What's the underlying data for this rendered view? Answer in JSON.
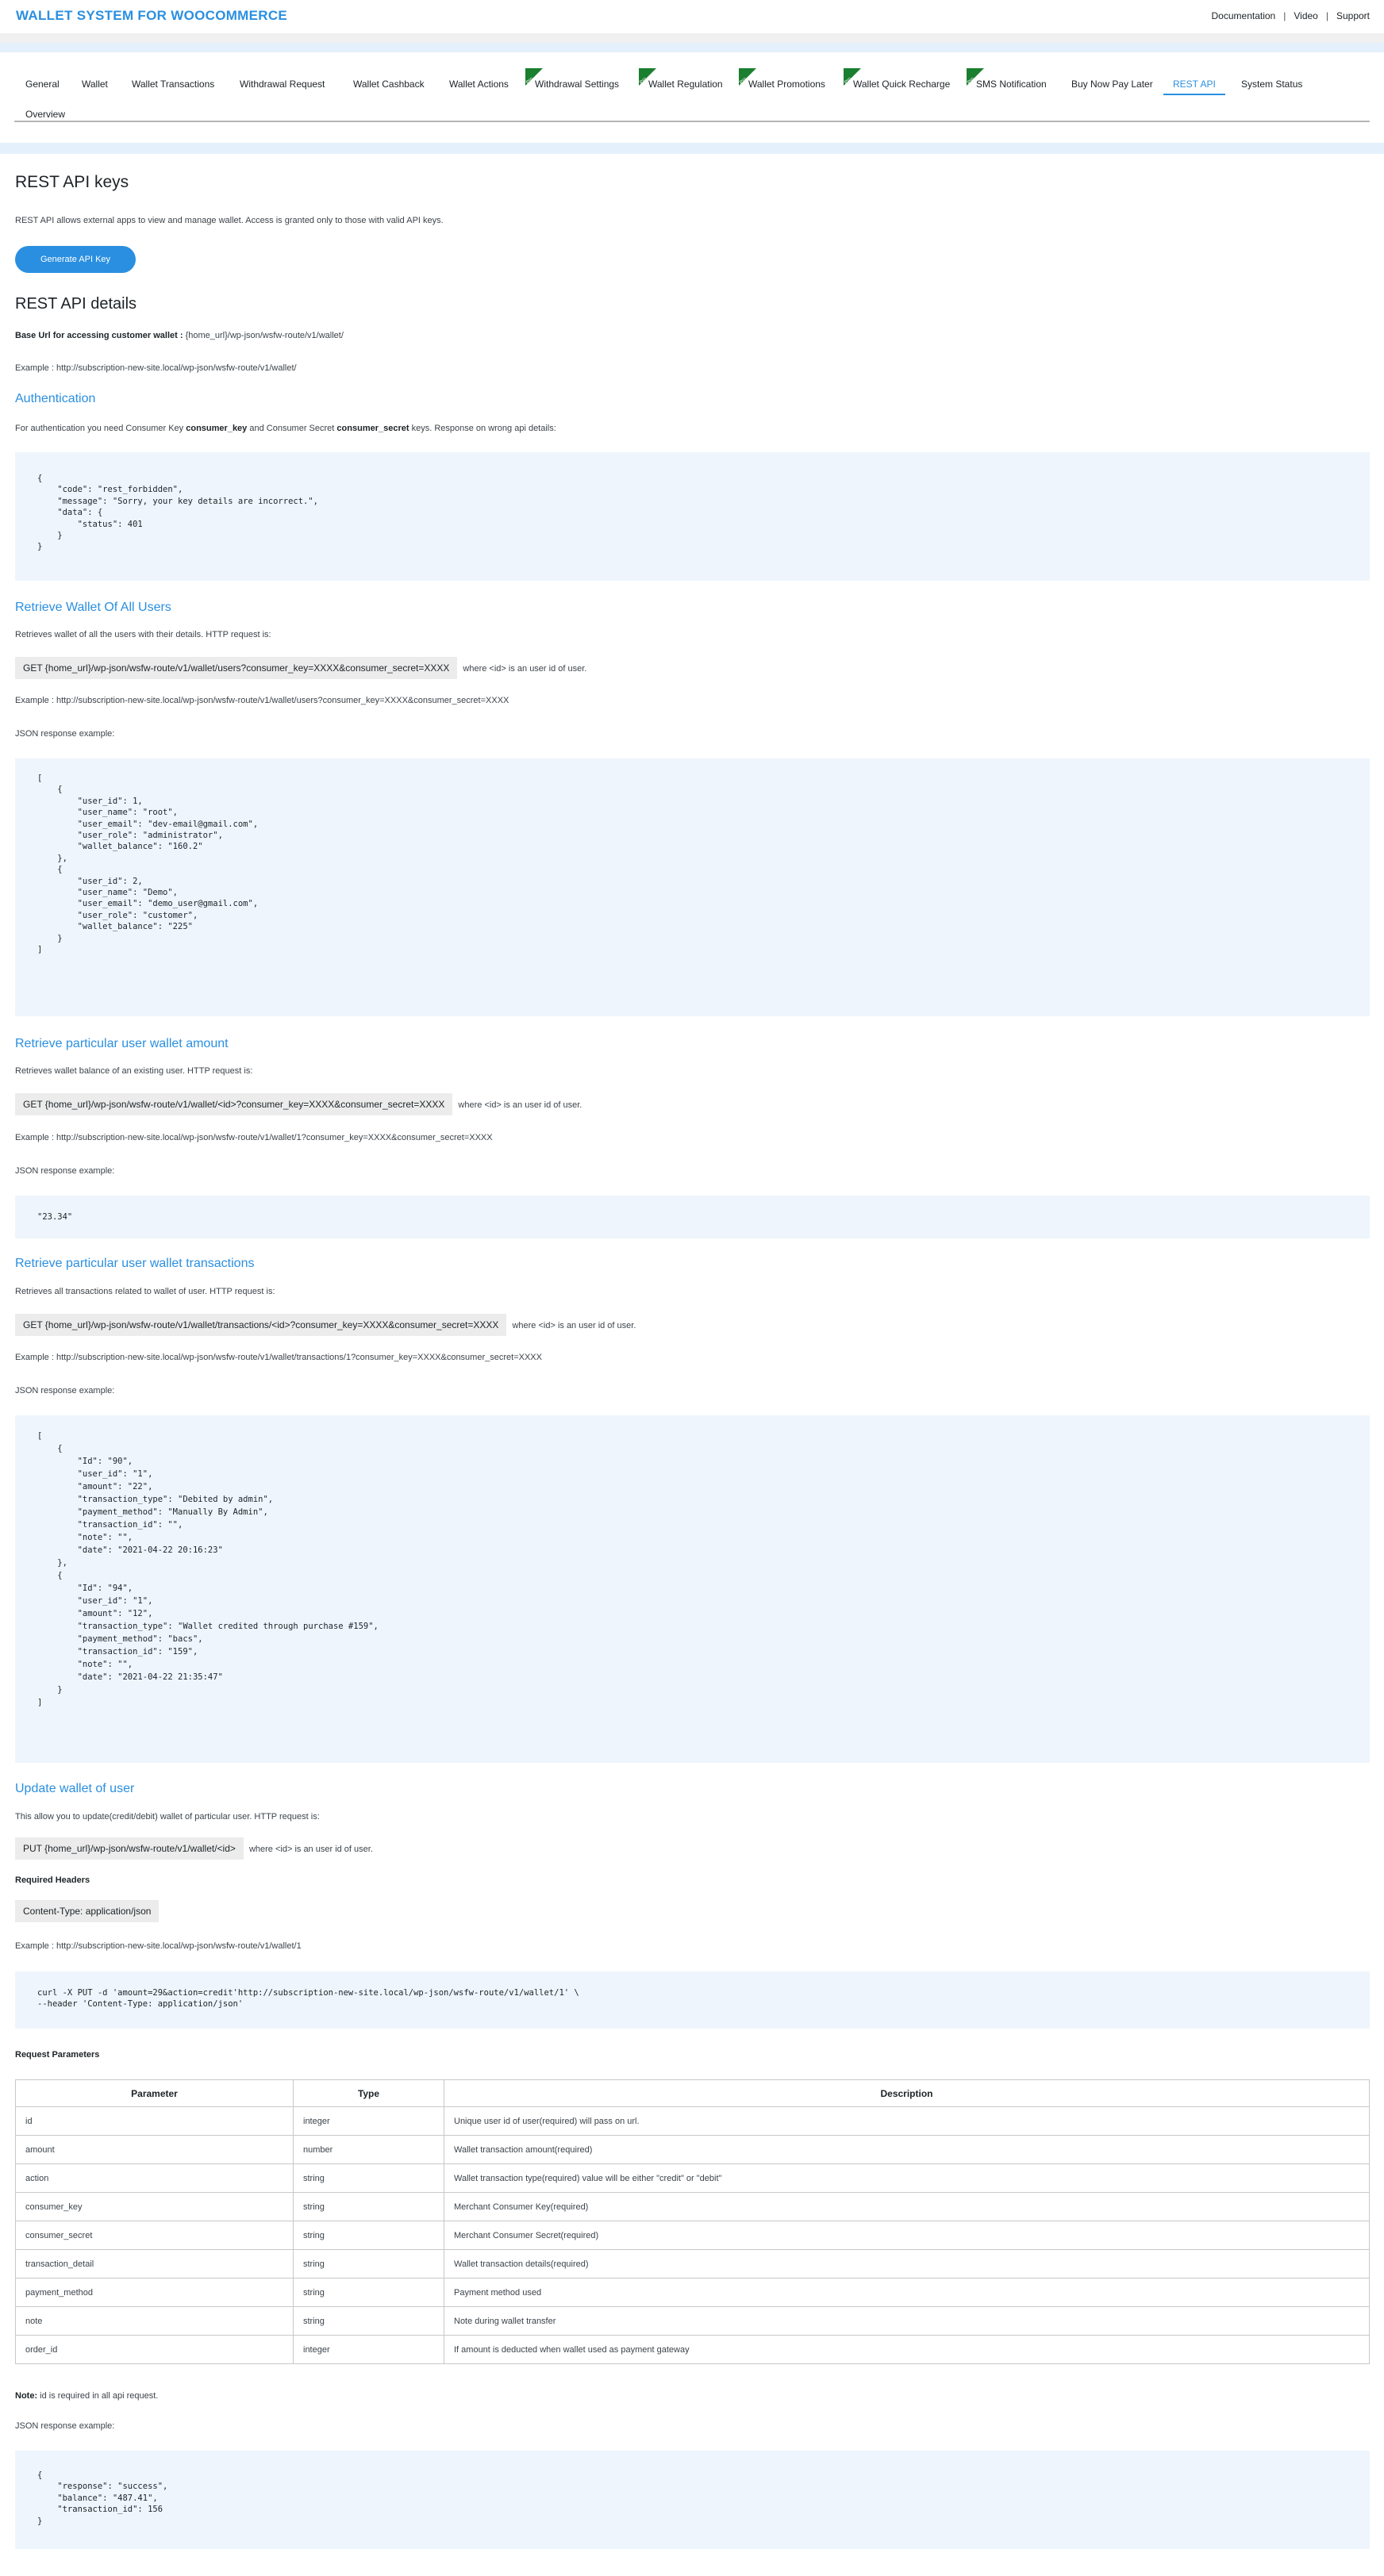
{
  "header": {
    "brand": "WALLET SYSTEM FOR WOOCOMMERCE",
    "links": [
      "Documentation",
      "Video",
      "Support"
    ],
    "separator": "|"
  },
  "nav": {
    "row1": [
      "General",
      "Wallet",
      "Wallet Transactions",
      "Withdrawal Request",
      "Wallet Cashback",
      "Wallet Actions",
      "Withdrawal Settings",
      "Wallet Regulation",
      "Wallet Promotions",
      "Wallet Quick Recharge",
      "SMS Notification",
      "Buy Now Pay Later",
      "REST API",
      "System Status"
    ],
    "row2": [
      "Overview"
    ],
    "pro_badge": "Pro",
    "active": "REST API"
  },
  "page": {
    "title": "REST API keys",
    "intro": "REST API allows external apps to view and manage wallet. Access is granted only to those with valid API keys.",
    "generate_button": "Generate API Key",
    "details_title": "REST API details",
    "base_url_label": "Base Url for accessing customer wallet :",
    "base_url_value": " {home_url}/wp-json/wsfw-route/v1/wallet/",
    "base_example": "Example : http://subscription-new-site.local/wp-json/wsfw-route/v1/wallet/"
  },
  "auth": {
    "title": "Authentication",
    "text_1": "For authentication you need Consumer Key ",
    "key_1": "consumer_key",
    "text_2": " and Consumer Secret ",
    "key_2": "consumer_secret",
    "text_3": " keys. Response on wrong api details:",
    "code": "{\n    \"code\": \"rest_forbidden\",\n    \"message\": \"Sorry, your key details are incorrect.\",\n    \"data\": {\n        \"status\": 401\n    }\n}"
  },
  "all_users": {
    "title": "Retrieve Wallet Of All Users",
    "desc": "Retrieves wallet of all the users with their details. HTTP request is:",
    "request": "GET {home_url}/wp-json/wsfw-route/v1/wallet/users?consumer_key=XXXX&consumer_secret=XXXX",
    "note": " where <id> is an user id of user.",
    "example": "Example : http://subscription-new-site.local/wp-json/wsfw-route/v1/wallet/users?consumer_key=XXXX&consumer_secret=XXXX",
    "json_label": "JSON response example:",
    "code": "[\n    {\n        \"user_id\": 1,\n        \"user_name\": \"root\",\n        \"user_email\": \"dev-email@gmail.com\",\n        \"user_role\": \"administrator\",\n        \"wallet_balance\": \"160.2\"\n    },\n    {\n        \"user_id\": 2,\n        \"user_name\": \"Demo\",\n        \"user_email\": \"demo_user@gmail.com\",\n        \"user_role\": \"customer\",\n        \"wallet_balance\": \"225\"\n    }\n]"
  },
  "user_amount": {
    "title": "Retrieve particular user wallet amount",
    "desc": "Retrieves wallet balance of an existing user. HTTP request is:",
    "request": "GET {home_url}/wp-json/wsfw-route/v1/wallet/<id>?consumer_key=XXXX&consumer_secret=XXXX",
    "note": " where <id> is an user id of user.",
    "example": "Example : http://subscription-new-site.local/wp-json/wsfw-route/v1/wallet/1?consumer_key=XXXX&consumer_secret=XXXX",
    "json_label": "JSON response example:",
    "code": "\"23.34\""
  },
  "user_transactions": {
    "title": "Retrieve particular user wallet transactions",
    "desc": "Retrieves all transactions related to wallet of user. HTTP request is:",
    "request": "GET {home_url}/wp-json/wsfw-route/v1/wallet/transactions/<id>?consumer_key=XXXX&consumer_secret=XXXX",
    "note": " where <id> is an user id of user.",
    "example": "Example : http://subscription-new-site.local/wp-json/wsfw-route/v1/wallet/transactions/1?consumer_key=XXXX&consumer_secret=XXXX",
    "json_label": "JSON response example:",
    "code": "[\n    {\n        \"Id\": \"90\",\n        \"user_id\": \"1\",\n        \"amount\": \"22\",\n        \"transaction_type\": \"Debited by admin\",\n        \"payment_method\": \"Manually By Admin\",\n        \"transaction_id\": \"\",\n        \"note\": \"\",\n        \"date\": \"2021-04-22 20:16:23\"\n    },\n    {\n        \"Id\": \"94\",\n        \"user_id\": \"1\",\n        \"amount\": \"12\",\n        \"transaction_type\": \"Wallet credited through purchase #159\",\n        \"payment_method\": \"bacs\",\n        \"transaction_id\": \"159\",\n        \"note\": \"\",\n        \"date\": \"2021-04-22 21:35:47\"\n    }\n]"
  },
  "update_wallet": {
    "title": "Update wallet of user",
    "desc": "This allow you to update(credit/debit) wallet of particular user. HTTP request is:",
    "request": "PUT {home_url}/wp-json/wsfw-route/v1/wallet/<id>",
    "note": " where <id> is an user id of user.",
    "headers_label": "Required Headers",
    "header_value": "Content-Type: application/json",
    "example": "Example : http://subscription-new-site.local/wp-json/wsfw-route/v1/wallet/1",
    "code": "curl -X PUT -d 'amount=29&action=credit'http://subscription-new-site.local/wp-json/wsfw-route/v1/wallet/1' \\\n--header 'Content-Type: application/json'",
    "params_label": "Request Parameters",
    "table": {
      "headers": [
        "Parameter",
        "Type",
        "Description"
      ],
      "rows": [
        [
          "id",
          "integer",
          "Unique user id of user(required) will pass on url."
        ],
        [
          "amount",
          "number",
          "Wallet transaction amount(required)"
        ],
        [
          "action",
          "string",
          "Wallet transaction type(required) value will be either \"credit\" or \"debit\""
        ],
        [
          "consumer_key",
          "string",
          "Merchant Consumer Key(required)"
        ],
        [
          "consumer_secret",
          "string",
          "Merchant Consumer Secret(required)"
        ],
        [
          "transaction_detail",
          "string",
          "Wallet transaction details(required)"
        ],
        [
          "payment_method",
          "string",
          "Payment method used"
        ],
        [
          "note",
          "string",
          "Note during wallet transfer"
        ],
        [
          "order_id",
          "integer",
          "If amount is deducted when wallet used as payment gateway"
        ]
      ]
    },
    "note_label": "Note:",
    "note_text": " id is required in all api request.",
    "json_label": "JSON response example:",
    "response_code": "{\n    \"response\": \"success\",\n    \"balance\": \"487.41\",\n    \"transaction_id\": 156\n}"
  }
}
